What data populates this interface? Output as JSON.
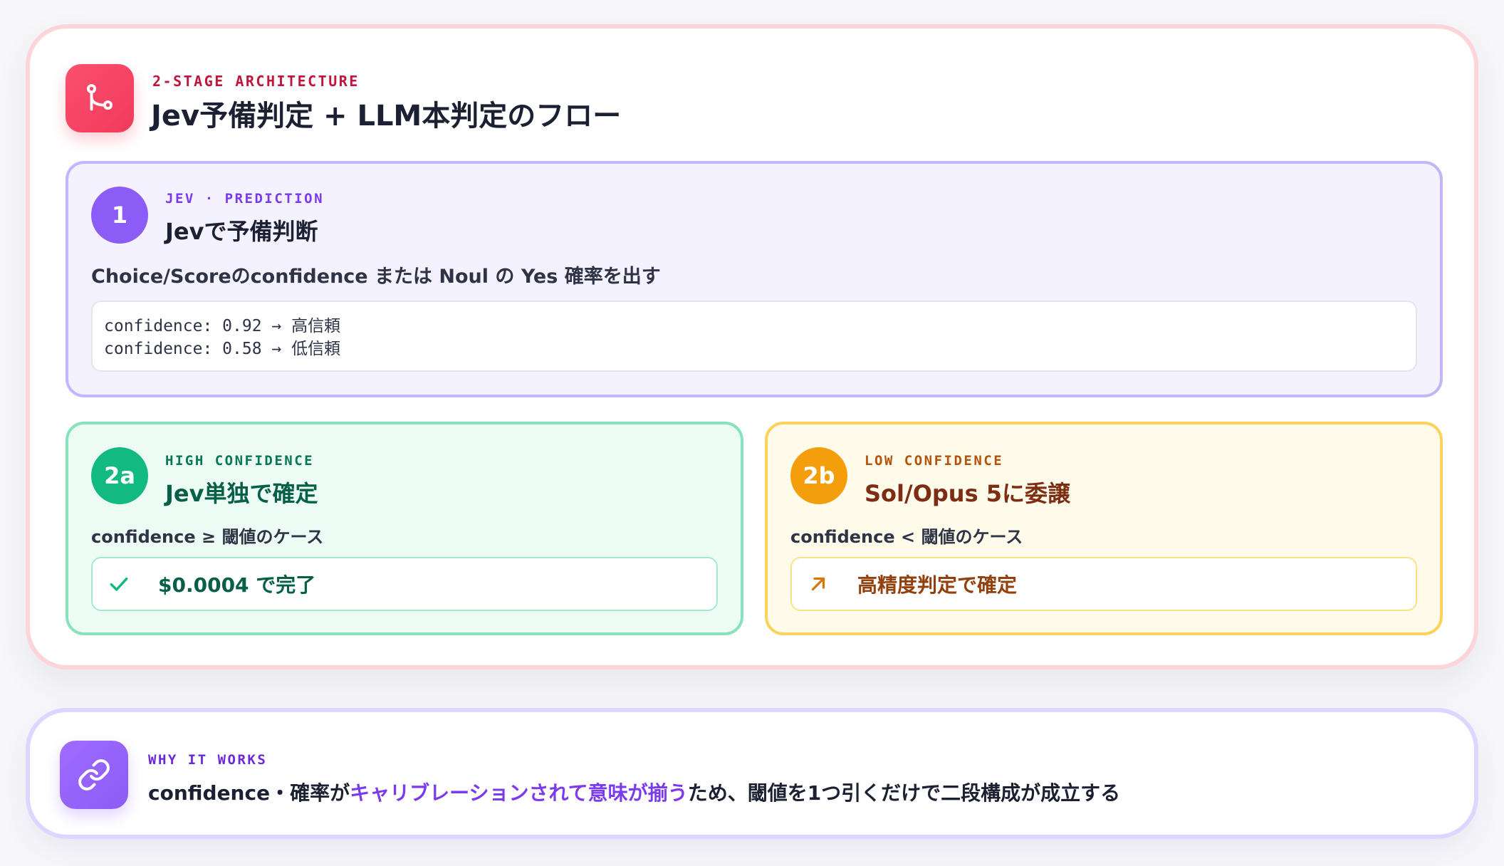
{
  "header": {
    "icon": "git-branch-icon",
    "kicker": "2-STAGE ARCHITECTURE",
    "title": "Jev予備判定 + LLM本判定のフロー"
  },
  "stage1": {
    "badge": "1",
    "kicker": "JEV · PREDICTION",
    "title": "Jevで予備判断",
    "description": "Choice/Scoreのconfidence または Noul の Yes 確率を出す",
    "code_lines": [
      "confidence: 0.92 → 高信頼",
      "confidence: 0.58 → 低信頼"
    ]
  },
  "stage2a": {
    "badge": "2a",
    "kicker": "HIGH CONFIDENCE",
    "title": "Jev単独で確定",
    "condition": "confidence ≥ 閾値のケース",
    "result_icon": "check-icon",
    "result": "$0.0004 で完了"
  },
  "stage2b": {
    "badge": "2b",
    "kicker": "LOW CONFIDENCE",
    "title": "Sol/Opus 5に委譲",
    "condition": "confidence < 閾値のケース",
    "result_icon": "arrow-up-right-icon",
    "result": "高精度判定で確定"
  },
  "why": {
    "icon": "link-icon",
    "kicker": "WHY IT WORKS",
    "text_before": "confidence・確率が",
    "text_highlight": "キャリブレーションされて意味が揃う",
    "text_after": "ため、閾値を1つ引くだけで二段構成が成立する"
  },
  "colors": {
    "header_accent": "#f13a5c",
    "stage1_accent": "#8b5cf6",
    "stage2a_accent": "#12b981",
    "stage2b_accent": "#f59e0b",
    "highlight": "#7c3aed"
  }
}
